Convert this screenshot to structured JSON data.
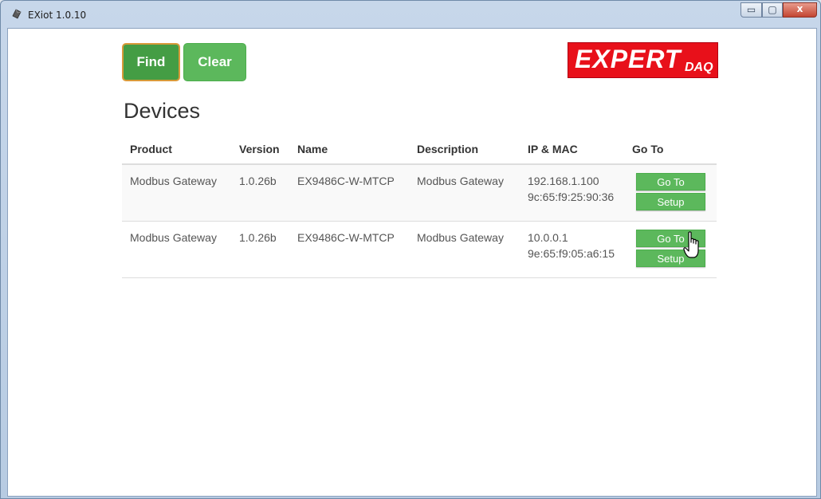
{
  "window": {
    "title": "EXiot 1.0.10",
    "controls": {
      "minimize": "▭",
      "maximize": "▢",
      "close": "x"
    }
  },
  "toolbar": {
    "find_label": "Find",
    "clear_label": "Clear"
  },
  "logo": {
    "main": "EXPERT",
    "sub": "DAQ",
    "color": "#e8101a"
  },
  "page": {
    "heading": "Devices"
  },
  "table": {
    "headers": [
      "Product",
      "Version",
      "Name",
      "Description",
      "IP & MAC",
      "Go To"
    ],
    "rows": [
      {
        "product": "Modbus Gateway",
        "version": "1.0.26b",
        "name": "EX9486C-W-MTCP",
        "description": "Modbus Gateway",
        "ip": "192.168.1.100",
        "mac": "9c:65:f9:25:90:36",
        "goto_label": "Go To",
        "setup_label": "Setup"
      },
      {
        "product": "Modbus Gateway",
        "version": "1.0.26b",
        "name": "EX9486C-W-MTCP",
        "description": "Modbus Gateway",
        "ip": "10.0.0.1",
        "mac": "9e:65:f9:05:a6:15",
        "goto_label": "Go To",
        "setup_label": "Setup"
      }
    ]
  },
  "colors": {
    "button_green": "#5cb85c",
    "button_green_active": "#449d44",
    "focus_outline": "#d99a3a"
  },
  "icons": {
    "app": "app-icon",
    "cursor": "hand-pointer-icon"
  }
}
